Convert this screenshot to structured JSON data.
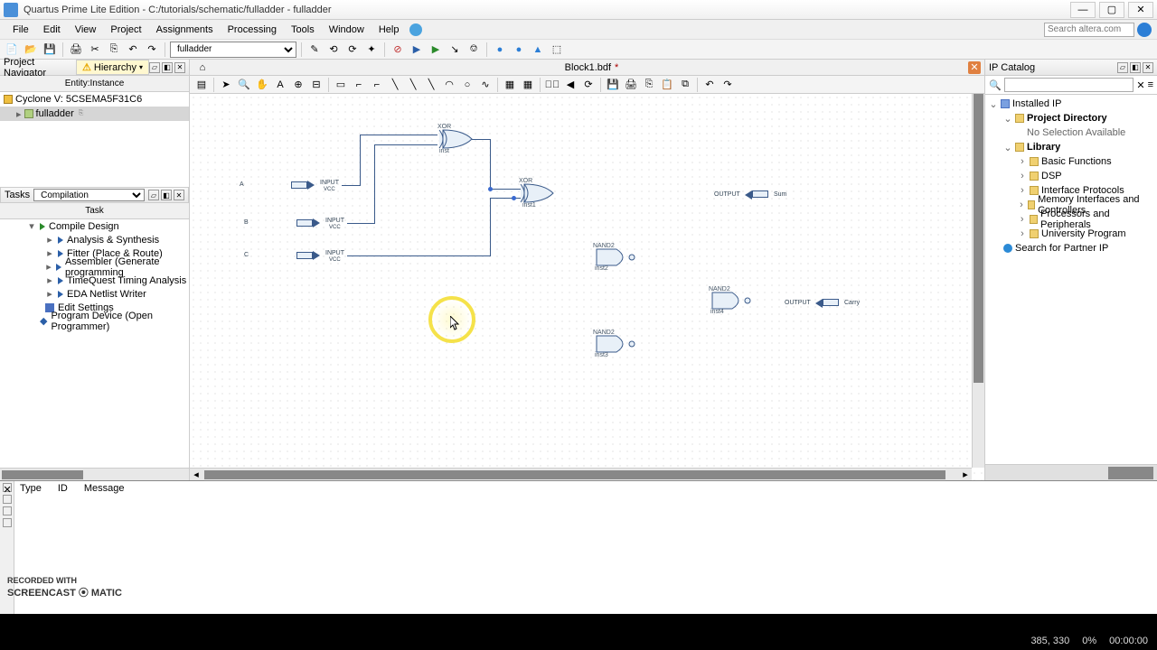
{
  "title_bar": {
    "title": "Quartus Prime Lite Edition - C:/tutorials/schematic/fulladder - fulladder"
  },
  "window_buttons": {
    "min": "—",
    "max": "▢",
    "close": "✕"
  },
  "menu": {
    "file": "File",
    "edit": "Edit",
    "view": "View",
    "project": "Project",
    "assignments": "Assignments",
    "processing": "Processing",
    "tools": "Tools",
    "window": "Window",
    "help": "Help"
  },
  "search": {
    "placeholder": "Search altera.com"
  },
  "entity_dropdown": "fulladder",
  "project_nav": {
    "panel": "Project Navigator",
    "tab": "Hierarchy",
    "col": "Entity:Instance",
    "device": "Cyclone V: 5CSEMA5F31C6",
    "top": "fulladder"
  },
  "tasks": {
    "panel": "Tasks",
    "combo": "Compilation",
    "col": "Task",
    "items": {
      "compile": "Compile Design",
      "analysis": "Analysis & Synthesis",
      "fitter": "Fitter (Place & Route)",
      "assembler": "Assembler (Generate programming",
      "timing": "TimeQuest Timing Analysis",
      "eda": "EDA Netlist Writer",
      "edit": "Edit Settings",
      "program": "Program Device (Open Programmer)"
    }
  },
  "editor": {
    "tab": "Block1.bdf",
    "dirty": "*"
  },
  "ip": {
    "panel": "IP Catalog",
    "installed": "Installed IP",
    "projdir": "Project Directory",
    "nosel": "No Selection Available",
    "library": "Library",
    "basic": "Basic Functions",
    "dsp": "DSP",
    "iface": "Interface Protocols",
    "mem": "Memory Interfaces and Controllers",
    "proc": "Processors and Peripherals",
    "univ": "University Program",
    "partner": "Search for Partner IP"
  },
  "messages": {
    "type": "Type",
    "id": "ID",
    "msg": "Message"
  },
  "schematic": {
    "xor1": "XOR",
    "xor2": "XOR",
    "nand1": "NAND2",
    "nand2": "NAND2",
    "nand3": "NAND2",
    "inst": "inst",
    "inst1": "inst1",
    "inst2": "inst2",
    "inst3": "inst3",
    "inst4": "inst4",
    "a": "A",
    "b": "B",
    "c": "C",
    "input": "INPUT",
    "output": "OUTPUT",
    "sum": "Sum",
    "carry": "Carry",
    "vcc": "VCC"
  },
  "status": {
    "coords": "385, 330",
    "zoom": "0%",
    "time": "00:00:00"
  },
  "watermark": {
    "l1": "RECORDED WITH",
    "l2": "SCREENCAST ⦿ MATIC"
  }
}
